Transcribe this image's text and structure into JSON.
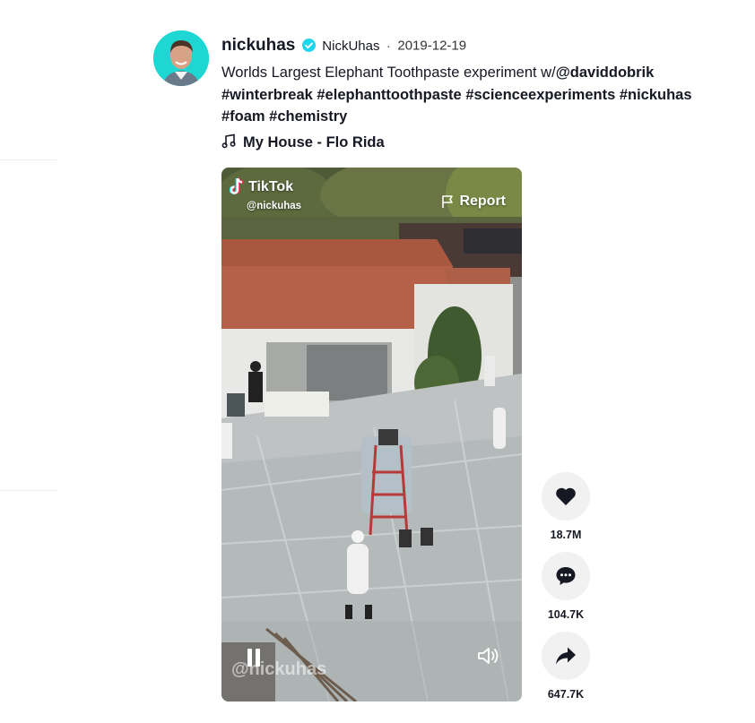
{
  "post": {
    "username": "nickuhas",
    "nickname": "NickUhas",
    "separator": "·",
    "date": "2019-12-19",
    "description_prefix": "Worlds Largest Elephant Toothpaste experiment w/",
    "mention": "@daviddobrik",
    "hashtags_line": "#winterbreak #elephanttoothpaste #scienceexperiments #nickuhas #foam #chemistry",
    "music": "My House - Flo Rida",
    "avatar_color": "#1fd7d2",
    "verified_color": "#20d5ec"
  },
  "video": {
    "brand": "TikTok",
    "handle": "@nickuhas",
    "report_label": "Report",
    "watermark": "@nickuhas"
  },
  "actions": {
    "likes": "18.7M",
    "comments": "104.7K",
    "shares": "647.7K"
  }
}
